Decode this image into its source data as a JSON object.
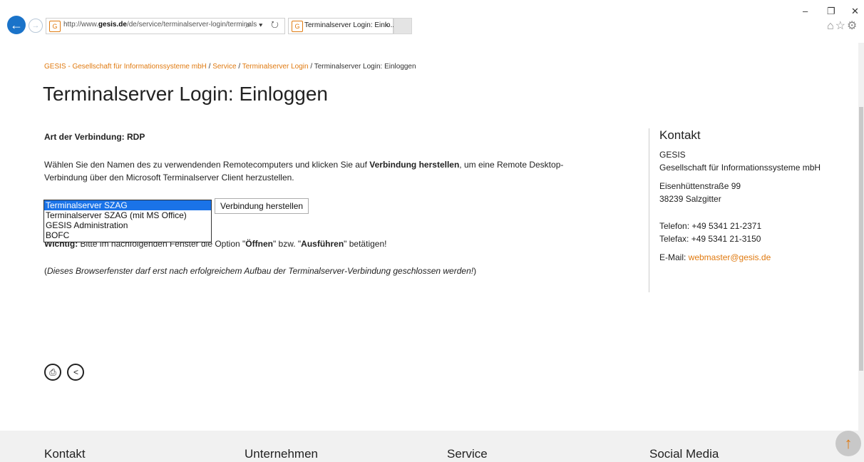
{
  "browser": {
    "url_prefix": "http://www.",
    "url_domain": "gesis.de",
    "url_path": "/de/service/terminalserver-login/terminals",
    "tab_title": "Terminalserver Login: Einlo...",
    "address_controls": "⌕ ▾ ↻",
    "window_controls": {
      "minimize": "–",
      "restore": "❐",
      "close": "✕"
    },
    "toolbar_icons": "⌂☆⚙"
  },
  "breadcrumb": {
    "items": [
      "GESIS - Gesellschaft für Informationssysteme mbH",
      "Service",
      "Terminalserver Login",
      "Terminalserver Login: Einloggen"
    ],
    "separator": " / "
  },
  "page": {
    "title": "Terminalserver Login: Einloggen",
    "connection_type": "Art der Verbindung: RDP",
    "description_part1": "Wählen Sie den Namen des zu verwendenden Remotecomputers und klicken Sie auf ",
    "description_bold": "Verbindung herstellen",
    "description_part2": ", um eine Remote Desktop-Verbindung über den Microsoft Terminalserver Client herzustellen.",
    "server_options": [
      "Terminalserver SZAG",
      "Terminalserver SZAG (mit MS Office)",
      "GESIS Administration",
      "BOFC"
    ],
    "selected_option": "Terminalserver SZAG",
    "connect_button": "Verbindung herstellen",
    "important_label": "Wichtig:",
    "important_text": " Bitte im nachfolgenden Fenster die Option \"",
    "important_open": "Öffnen",
    "important_mid": "\" bzw. \"",
    "important_run": "Ausführen",
    "important_end": "\" betätigen!",
    "note_open": "(",
    "note_italic": "Dieses Browserfenster darf erst nach erfolgreichem Aufbau der Terminalserver-Verbindung geschlossen werden!",
    "note_close": ")"
  },
  "sidebar": {
    "heading": "Kontakt",
    "org_name": "GESIS",
    "org_full": "Gesellschaft für Informationssysteme mbH",
    "street": "Eisenhüttenstraße 99",
    "city": "38239 Salzgitter",
    "phone": "Telefon: +49 5341 21-2371",
    "fax": "Telefax: +49 5341 21-3150",
    "email_label": "E-Mail: ",
    "email": "webmaster@gesis.de"
  },
  "footer": {
    "columns": [
      "Kontakt",
      "Unternehmen",
      "Service",
      "Social Media"
    ]
  },
  "icons": {
    "back": "←",
    "forward": "→",
    "print": "⎙",
    "share": "<",
    "to_top": "↑"
  },
  "colors": {
    "link_orange": "#e07a10",
    "select_blue": "#1a73e8",
    "back_blue": "#1a73c9"
  }
}
